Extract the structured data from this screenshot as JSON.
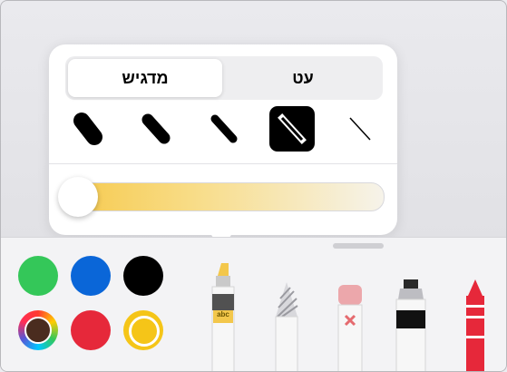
{
  "popover": {
    "segments": [
      {
        "label": "עט",
        "selected": false
      },
      {
        "label": "מדגיש",
        "selected": true
      }
    ],
    "widths": [
      "extra-thick",
      "thick",
      "medium",
      "thin",
      "extra-thin"
    ],
    "selected_width": "thin",
    "opacity_fraction": 0.0,
    "highlighter_color": "#f6c94b"
  },
  "toolbar": {
    "colors": [
      {
        "name": "green",
        "hex": "#34c759"
      },
      {
        "name": "blue",
        "hex": "#0a66d8"
      },
      {
        "name": "black",
        "hex": "#000000"
      },
      {
        "name": "color-picker",
        "hex": "#4a2c1f"
      },
      {
        "name": "red",
        "hex": "#e6283a"
      },
      {
        "name": "yellow",
        "hex": "#f5c518",
        "selected": true
      }
    ],
    "tools": [
      {
        "name": "highlighter",
        "label": "abc",
        "selected": true
      },
      {
        "name": "pencil"
      },
      {
        "name": "eraser"
      },
      {
        "name": "marker"
      },
      {
        "name": "crayon"
      }
    ]
  }
}
